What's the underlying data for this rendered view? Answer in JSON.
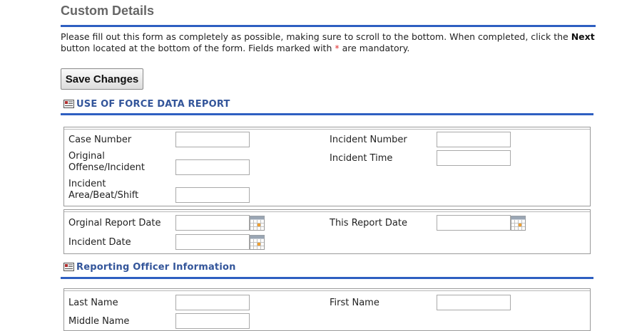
{
  "page": {
    "title": "Custom Details",
    "instructions_part1": "Please fill out this form as completely as possible, making sure to scroll to the bottom.  When completed, click the ",
    "instructions_bold": "Next",
    "instructions_part2": " button located at the bottom of the form. Fields marked with ",
    "required_marker": "*",
    "instructions_part3": " are mandatory."
  },
  "toolbar": {
    "save_label": "Save Changes"
  },
  "sections": {
    "use_of_force": {
      "title": "USE OF FORCE DATA REPORT",
      "icon": "form-icon"
    },
    "reporting_officer": {
      "title": "Reporting Officer Information",
      "icon": "form-icon"
    }
  },
  "fields": {
    "case_number": {
      "label": "Case Number",
      "value": ""
    },
    "incident_number": {
      "label": "Incident Number",
      "value": ""
    },
    "original_offense": {
      "label": "Original Offense/Incident",
      "value": ""
    },
    "incident_time": {
      "label": "Incident Time",
      "value": ""
    },
    "incident_area": {
      "label": "Incident Area/Beat/Shift",
      "value": ""
    },
    "orginal_report_date": {
      "label": "Orginal Report Date",
      "value": ""
    },
    "this_report_date": {
      "label": "This Report Date",
      "value": ""
    },
    "incident_date": {
      "label": "Incident Date",
      "value": ""
    },
    "last_name": {
      "label": "Last Name",
      "value": ""
    },
    "first_name": {
      "label": "First Name",
      "value": ""
    },
    "middle_name": {
      "label": "Middle Name",
      "value": ""
    }
  },
  "colors": {
    "accent_rule": "#2e5fc1",
    "section_title": "#33559a",
    "required": "#e03030"
  }
}
